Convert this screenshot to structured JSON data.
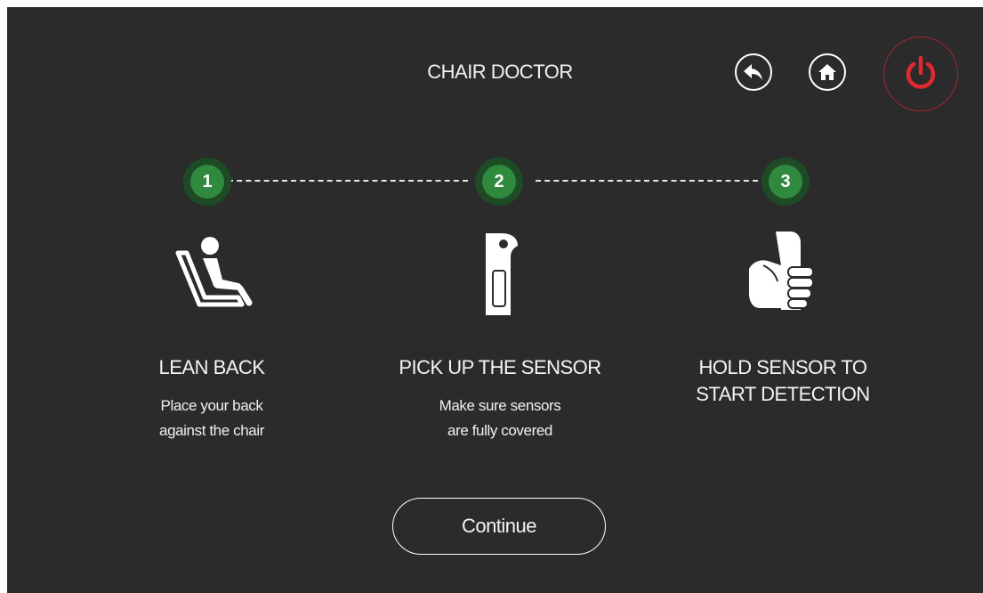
{
  "header": {
    "title": "CHAIR DOCTOR",
    "back_icon": "back-arrow-icon",
    "home_icon": "home-icon",
    "power_icon": "power-icon",
    "power_color": "#e02a2f"
  },
  "steps": [
    {
      "number": "1",
      "icon": "lean-back-chair-icon",
      "title": "LEAN BACK",
      "desc_line1": "Place your back",
      "desc_line2": "against the chair"
    },
    {
      "number": "2",
      "icon": "sensor-handle-icon",
      "title": "PICK UP THE SENSOR",
      "desc_line1": "Make sure sensors",
      "desc_line2": "are fully covered"
    },
    {
      "number": "3",
      "icon": "hand-holding-sensor-icon",
      "title_line1": "HOLD SENSOR TO",
      "title_line2": "START DETECTION"
    }
  ],
  "continue_label": "Continue",
  "colors": {
    "background": "#2b2b2b",
    "step_accent": "#2f8a3e",
    "step_ring": "#1e4a26"
  }
}
